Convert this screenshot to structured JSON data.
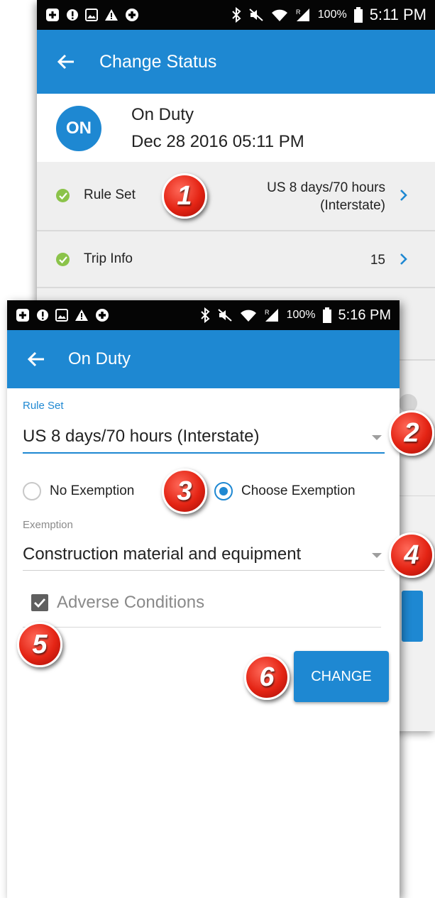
{
  "back_screen": {
    "statusbar": {
      "battery": "100%",
      "time": "5:11 PM"
    },
    "appbar": {
      "title": "Change Status"
    },
    "status_header": {
      "badge": "ON",
      "status": "On Duty",
      "datetime": "Dec 28 2016 05:11 PM"
    },
    "rows": [
      {
        "label": "Rule Set",
        "value_line1": "US 8 days/70 hours",
        "value_line2": "(Interstate)"
      },
      {
        "label": "Trip Info",
        "value": "15"
      }
    ]
  },
  "front_screen": {
    "statusbar": {
      "battery": "100%",
      "time": "5:16 PM"
    },
    "appbar": {
      "title": "On Duty"
    },
    "rule_set": {
      "label": "Rule Set",
      "value": "US 8 days/70 hours (Interstate)"
    },
    "exemption_options": [
      {
        "label": "No Exemption",
        "selected": false
      },
      {
        "label": "Choose Exemption",
        "selected": true
      }
    ],
    "exemption": {
      "label": "Exemption",
      "value": "Construction material and equipment"
    },
    "adverse_conditions": {
      "label": "Adverse Conditions",
      "checked": true
    },
    "change_button": "CHANGE"
  },
  "markers": [
    "1",
    "2",
    "3",
    "4",
    "5",
    "6"
  ],
  "colors": {
    "accent": "#1e88d2",
    "check_green": "#8bc34a",
    "marker_red": "#e42414"
  }
}
